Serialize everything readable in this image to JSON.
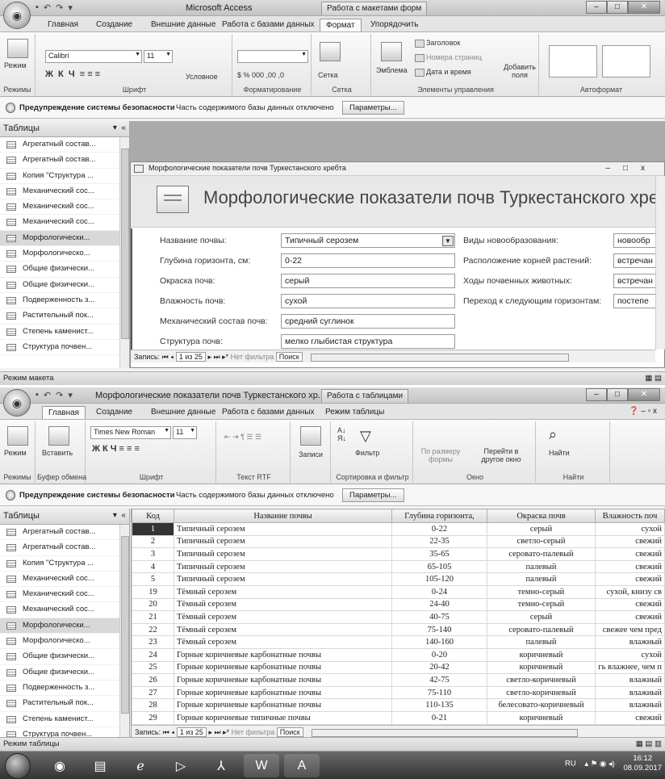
{
  "access_title": "Microsoft Access",
  "w1": {
    "ctx_tab": "Работа с макетами форм",
    "tabs": [
      "Главная",
      "Создание",
      "Внешние данные",
      "Работа с базами данных",
      "Формат",
      "Упорядочить"
    ],
    "ribbon": {
      "mode": "Режим",
      "modes_label": "Режимы",
      "font": "Calibri",
      "size": "11",
      "font_group": "Шрифт",
      "conditional": "Условное",
      "number_format": "",
      "formatting_group": "Форматирование",
      "grid": "Сетка",
      "grid_group": "Сетка",
      "emblem": "Эмблема",
      "header": "Заголовок",
      "page_numbers": "Номера страниц",
      "date_time": "Дата и время",
      "add_fields": "Добавить поля",
      "controls_group": "Элементы управления",
      "autoformat_group": "Автоформат"
    },
    "status": "Режим макета"
  },
  "security": {
    "label": "Предупреждение системы безопасности",
    "msg": "Часть содержимого базы данных отключено",
    "btn": "Параметры..."
  },
  "nav": {
    "title": "Таблицы",
    "items": [
      "Агрегатный состав...",
      "Агрегатный состав...",
      "Копия \"Структура ...",
      "Механический сос...",
      "Механический сос...",
      "Механический сос...",
      "Морфологически...",
      "Морфологическо...",
      "Общие физически...",
      "Общие физически...",
      "Подверженность з...",
      "Растительный пок...",
      "Степень каменист...",
      "Структура почвен..."
    ]
  },
  "nav2": {
    "items": [
      "Агрегатный состав...",
      "Агрегатный состав...",
      "Копия \"Структура ...",
      "Механический сос...",
      "Механический сос...",
      "Механический сос...",
      "Морфологически...",
      "Морфологическо...",
      "Общие физически...",
      "Общие физически...",
      "Подверженность з...",
      "Растительный пок...",
      "Степень каменист...",
      "Структура почвен..."
    ]
  },
  "form": {
    "window_title": "Морфологические показатели почв Туркестанского хребта",
    "heading": "Морфологические показатели почв Туркестанского хребта",
    "fields": [
      {
        "label": "Название почвы:",
        "value": "Типичный серозем"
      },
      {
        "label": "Глубина горизонта, см:",
        "value": "0-22"
      },
      {
        "label": "Окраска почв:",
        "value": "серый"
      },
      {
        "label": "Влажность почв:",
        "value": "сухой"
      },
      {
        "label": "Механический состав почв:",
        "value": "средний суглинок"
      },
      {
        "label": "Структура почв:",
        "value": "мелко глыбистая структура"
      }
    ],
    "fields_right": [
      {
        "label": "Виды новообразования:",
        "value": "новообр"
      },
      {
        "label": "Расположение корней растений:",
        "value": "встречан"
      },
      {
        "label": "Ходы почвенных животных:",
        "value": "встречан"
      },
      {
        "label": "Переход к следующим горизонтам:",
        "value": "постепе"
      }
    ],
    "recnav": {
      "label": "Запись:",
      "pos": "1 из 25",
      "filter": "Нет фильтра",
      "search": "Поиск"
    }
  },
  "w2": {
    "title": "Морфологические показатели почв Туркестанского хр...",
    "ctx_tab": "Работа с таблицами",
    "tabs": [
      "Главная",
      "Создание",
      "Внешние данные",
      "Работа с базами данных",
      "Режим таблицы"
    ],
    "ribbon": {
      "mode": "Режим",
      "modes_label": "Режимы",
      "paste": "Вставить",
      "clipboard": "Буфер обмена",
      "font": "Times New Roman",
      "size": "11",
      "font_group": "Шрифт",
      "rtf_group": "Текст RTF",
      "records": "Записи",
      "filter": "Фильтр",
      "sort_group": "Сортировка и фильтр",
      "fit": "По размеру формы",
      "goto": "Перейти в другое окно",
      "window_group": "Окно",
      "find": "Найти",
      "find_group": "Найти"
    },
    "status": "Режим таблицы"
  },
  "table": {
    "headers": [
      "Код",
      "Название почвы",
      "Глубина горизонта,",
      "Окраска почв",
      "Влажность поч"
    ],
    "rows": [
      [
        "1",
        "Типичный серозем",
        "0-22",
        "серый",
        "сухой"
      ],
      [
        "2",
        "Типичный серозем",
        "22-35",
        "светло-серый",
        "свежий"
      ],
      [
        "3",
        "Типичный серозем",
        "35-65",
        "серовато-палевый",
        "свежий"
      ],
      [
        "4",
        "Типичный серозем",
        "65-105",
        "палевый",
        "свежий"
      ],
      [
        "5",
        "Типичный серозем",
        "105-120",
        "палевый",
        "свежий"
      ],
      [
        "19",
        "Тёмный серозем",
        "0-24",
        "темно-серый",
        "сухой, книзу св"
      ],
      [
        "20",
        "Тёмный серозем",
        "24-40",
        "темно-серый",
        "свежий"
      ],
      [
        "21",
        "Тёмный серозем",
        "40-75",
        "серый",
        "свежий"
      ],
      [
        "22",
        "Тёмный серозем",
        "75-140",
        "серовато-палевый",
        "свежее чем пред"
      ],
      [
        "23",
        "Тёмный серозем",
        "140-160",
        "палевый",
        "влажный"
      ],
      [
        "24",
        "Горные коричневые карбонатные почвы",
        "0-20",
        "коричневый",
        "сухой"
      ],
      [
        "25",
        "Горные коричневые карбонатные почвы",
        "20-42",
        "коричневый",
        "гь влажнее, чем п"
      ],
      [
        "26",
        "Горные коричневые карбонатные почвы",
        "42-75",
        "светло-коричневый",
        "влажный"
      ],
      [
        "27",
        "Горные коричневые карбонатные почвы",
        "75-110",
        "светло-коричневый",
        "влажный"
      ],
      [
        "28",
        "Горные коричневые карбонатные почвы",
        "110-135",
        "белесовато-коричневый",
        "влажный"
      ],
      [
        "29",
        "Горные коричневые типичные почвы",
        "0-21",
        "коричневый",
        "свежий"
      ]
    ]
  },
  "tablenav": {
    "label": "Запись:",
    "pos": "1 из 25",
    "filter": "Нет фильтра",
    "search": "Поиск"
  },
  "tray": {
    "lang": "RU",
    "time": "16:12",
    "date": "08.09.2017"
  }
}
